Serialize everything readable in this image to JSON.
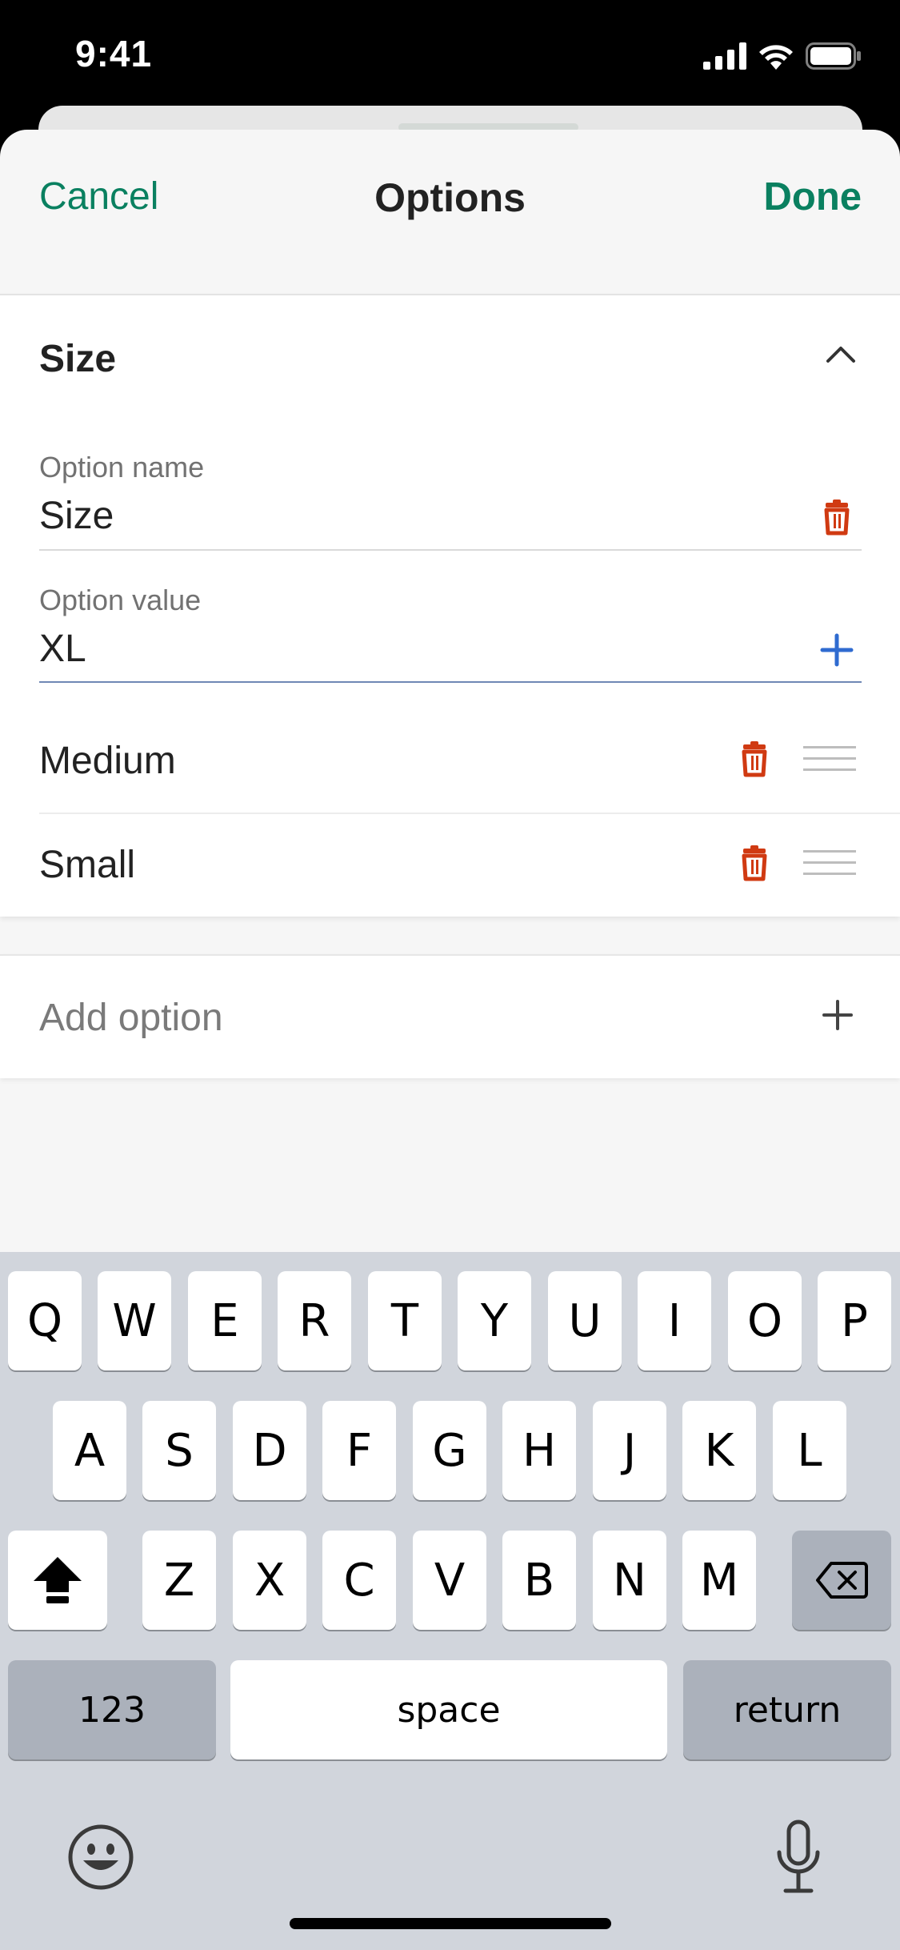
{
  "status_bar": {
    "time": "9:41"
  },
  "nav": {
    "cancel": "Cancel",
    "title": "Options",
    "done": "Done"
  },
  "section": {
    "title": "Size",
    "option_name": {
      "label": "Option name",
      "value": "Size"
    },
    "option_value": {
      "label": "Option value",
      "value": "XL"
    },
    "values": [
      "Medium",
      "Small"
    ]
  },
  "add_option": {
    "label": "Add option"
  },
  "keyboard": {
    "row1": [
      "Q",
      "W",
      "E",
      "R",
      "T",
      "Y",
      "U",
      "I",
      "O",
      "P"
    ],
    "row2": [
      "A",
      "S",
      "D",
      "F",
      "G",
      "H",
      "J",
      "K",
      "L"
    ],
    "row3": [
      "Z",
      "X",
      "C",
      "V",
      "B",
      "N",
      "M"
    ],
    "numbers": "123",
    "space": "space",
    "return": "return"
  },
  "colors": {
    "accent_green": "#0a8060",
    "delete_red": "#d03a12",
    "add_blue": "#2f6bd0"
  }
}
